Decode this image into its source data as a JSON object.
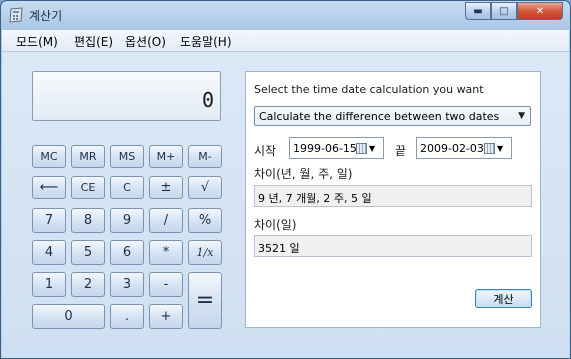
{
  "window": {
    "title": "계산기",
    "min_symbol": "▬",
    "max_symbol": "□",
    "close_symbol": "✕"
  },
  "menu": [
    "모드(M)",
    "편집(E)",
    "옵션(O)",
    "도움말(H)"
  ],
  "display": {
    "value": "0"
  },
  "keys": {
    "mc": "MC",
    "mr": "MR",
    "ms": "MS",
    "mplus": "M+",
    "mminus": "M-",
    "back": "⟵",
    "ce": "CE",
    "c": "C",
    "sign": "±",
    "sqrt": "√",
    "d7": "7",
    "d8": "8",
    "d9": "9",
    "div": "/",
    "pct": "%",
    "d4": "4",
    "d5": "5",
    "d6": "6",
    "mul": "*",
    "recip": "1/x",
    "d1": "1",
    "d2": "2",
    "d3": "3",
    "sub": "-",
    "eq": "=",
    "d0": "0",
    "dot": ".",
    "add": "+"
  },
  "panel": {
    "prompt": "Select the time date calculation you want",
    "mode_selected": "Calculate the difference between two dates",
    "start_label": "시작",
    "start_date": "1999-06-15",
    "end_label": "끝",
    "end_date": "2009-02-03",
    "diff_label": "차이(년, 월, 주, 일)",
    "diff_value": "9 년, 7 개월, 2 주, 5 일",
    "days_label": "차이(일)",
    "days_value": "3521 일",
    "calc_button": "계산"
  },
  "colors": {
    "window_blue": "#a9c6e6",
    "close_red": "#c33b1d"
  }
}
